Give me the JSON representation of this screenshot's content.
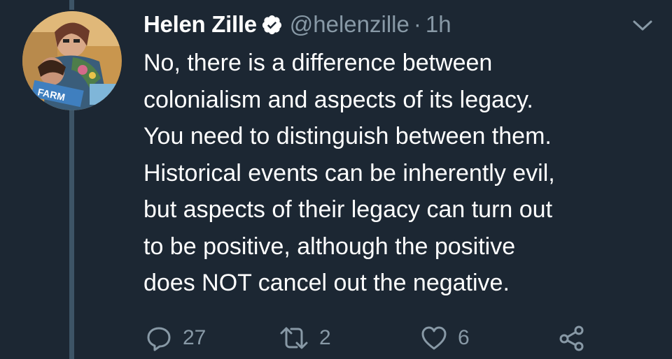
{
  "tweet": {
    "author_name": "Helen Zille",
    "handle": "@helenzille",
    "separator": "·",
    "time": "1h",
    "text_lines": [
      "No, there is a difference between",
      "colonialism and aspects of its legacy.",
      "You need to distinguish between them.",
      "Historical events can be inherently evil,",
      "but aspects of their legacy can turn out",
      "to be positive, although the positive",
      "does NOT cancel out the negative."
    ],
    "avatar_sign_text": "FARM"
  },
  "actions": {
    "reply_count": "27",
    "retweet_count": "2",
    "like_count": "6"
  },
  "colors": {
    "background": "#1c2733",
    "text": "#ffffff",
    "secondary": "#8899a6",
    "thread_line": "#3d5466"
  },
  "icons": {
    "verified": "verified-badge-icon",
    "menu": "chevron-down-icon",
    "reply": "reply-icon",
    "retweet": "retweet-icon",
    "like": "heart-icon",
    "share": "share-icon"
  }
}
